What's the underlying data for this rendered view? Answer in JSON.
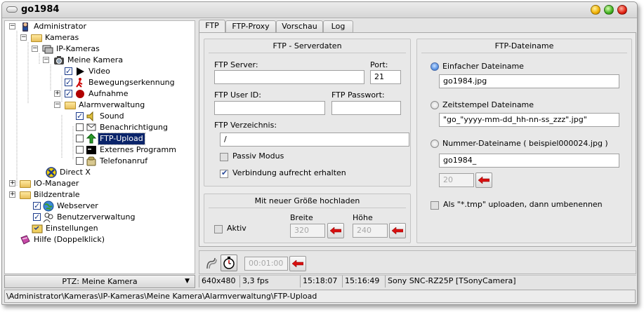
{
  "window": {
    "title": "go1984"
  },
  "tree": [
    {
      "label": "Administrator",
      "icon": "admin-icon",
      "expander": "minus",
      "check": null
    },
    {
      "label": "Kameras",
      "icon": "folder-icon",
      "expander": "minus",
      "check": null
    },
    {
      "label": "IP-Kameras",
      "icon": "network-camera-icon",
      "expander": "minus",
      "check": null
    },
    {
      "label": "Meine Kamera",
      "icon": "camera-icon",
      "expander": "minus",
      "check": null
    },
    {
      "label": "Video",
      "icon": "play-icon",
      "expander": null,
      "check": true
    },
    {
      "label": "Bewegungserkennung",
      "icon": "motion-icon",
      "expander": null,
      "check": true
    },
    {
      "label": "Aufnahme",
      "icon": "record-icon",
      "expander": "plus",
      "check": true
    },
    {
      "label": "Alarmverwaltung",
      "icon": "folder-icon",
      "expander": "minus",
      "check": null
    },
    {
      "label": "Sound",
      "icon": "speaker-icon",
      "expander": null,
      "check": true
    },
    {
      "label": "Benachrichtigung",
      "icon": "notification-icon",
      "expander": null,
      "check": false
    },
    {
      "label": "FTP-Upload",
      "icon": "ftp-icon",
      "expander": null,
      "check": false,
      "selected": true
    },
    {
      "label": "Externes Programm",
      "icon": "program-icon",
      "expander": null,
      "check": false
    },
    {
      "label": "Telefonanruf",
      "icon": "phone-icon",
      "expander": null,
      "check": false
    },
    {
      "label": "Direct X",
      "icon": "directx-icon",
      "expander": null,
      "check": null
    },
    {
      "label": "IO-Manager",
      "icon": "folder-icon",
      "expander": "plus",
      "check": null
    },
    {
      "label": "Bildzentrale",
      "icon": "folder-icon",
      "expander": "plus",
      "check": null
    },
    {
      "label": "Webserver",
      "icon": "globe-icon",
      "expander": null,
      "check": true
    },
    {
      "label": "Benutzerverwaltung",
      "icon": "users-icon",
      "expander": null,
      "check": true
    },
    {
      "label": "Einstellungen",
      "icon": "settings-icon",
      "expander": null,
      "check": null
    },
    {
      "label": "Hilfe (Doppelklick)",
      "icon": "help-book-icon",
      "expander": null,
      "check": null
    }
  ],
  "ptz": {
    "label": "PTZ: Meine Kamera"
  },
  "tabs": [
    "FTP",
    "FTP-Proxy",
    "Vorschau",
    "Log"
  ],
  "server_group": {
    "title": "FTP - Serverdaten",
    "server_label": "FTP Server:",
    "server_value": "",
    "port_label": "Port:",
    "port_value": "21",
    "user_label": "FTP User ID:",
    "user_value": "",
    "pass_label": "FTP Passwort:",
    "pass_value": "",
    "dir_label": "FTP Verzeichnis:",
    "dir_value": "/",
    "passive_label": "Passiv Modus",
    "passive_checked": false,
    "keepalive_label": "Verbindung aufrecht erhalten",
    "keepalive_checked": true
  },
  "resize_group": {
    "title": "Mit neuer Größe hochladen",
    "active_label": "Aktiv",
    "active_checked": false,
    "width_label": "Breite",
    "width_value": "320",
    "height_label": "Höhe",
    "height_value": "240"
  },
  "filename_group": {
    "title": "FTP-Dateiname",
    "simple_label": "Einfacher Dateiname",
    "simple_value": "go1984.jpg",
    "timestamp_label": "Zeitstempel Dateiname",
    "timestamp_value": "\"go_\"yyyy-mm-dd_hh-nn-ss_zzz\".jpg\"",
    "number_label": "Nummer-Dateiname ( beispiel000024.jpg )",
    "number_value": "go1984_",
    "number_start": "20",
    "selected": "simple",
    "tmp_label": "Als \"*.tmp\" uploaden, dann umbenennen",
    "tmp_checked": false
  },
  "toolbar": {
    "timer_value": "00:01:00"
  },
  "status": {
    "resolution": "640x480",
    "fps": "3,3 fps",
    "time1": "15:18:07",
    "time2": "15:16:49",
    "camera": "Sony SNC-RZ25P [TSonyCamera]"
  },
  "path": "\\Administrator\\Kameras\\IP-Kameras\\Meine Kamera\\Alarmverwaltung\\FTP-Upload",
  "colors": {
    "selection": "#0a246a",
    "radio_selected": "#4a88e0",
    "arrow_red": "#d81010"
  }
}
